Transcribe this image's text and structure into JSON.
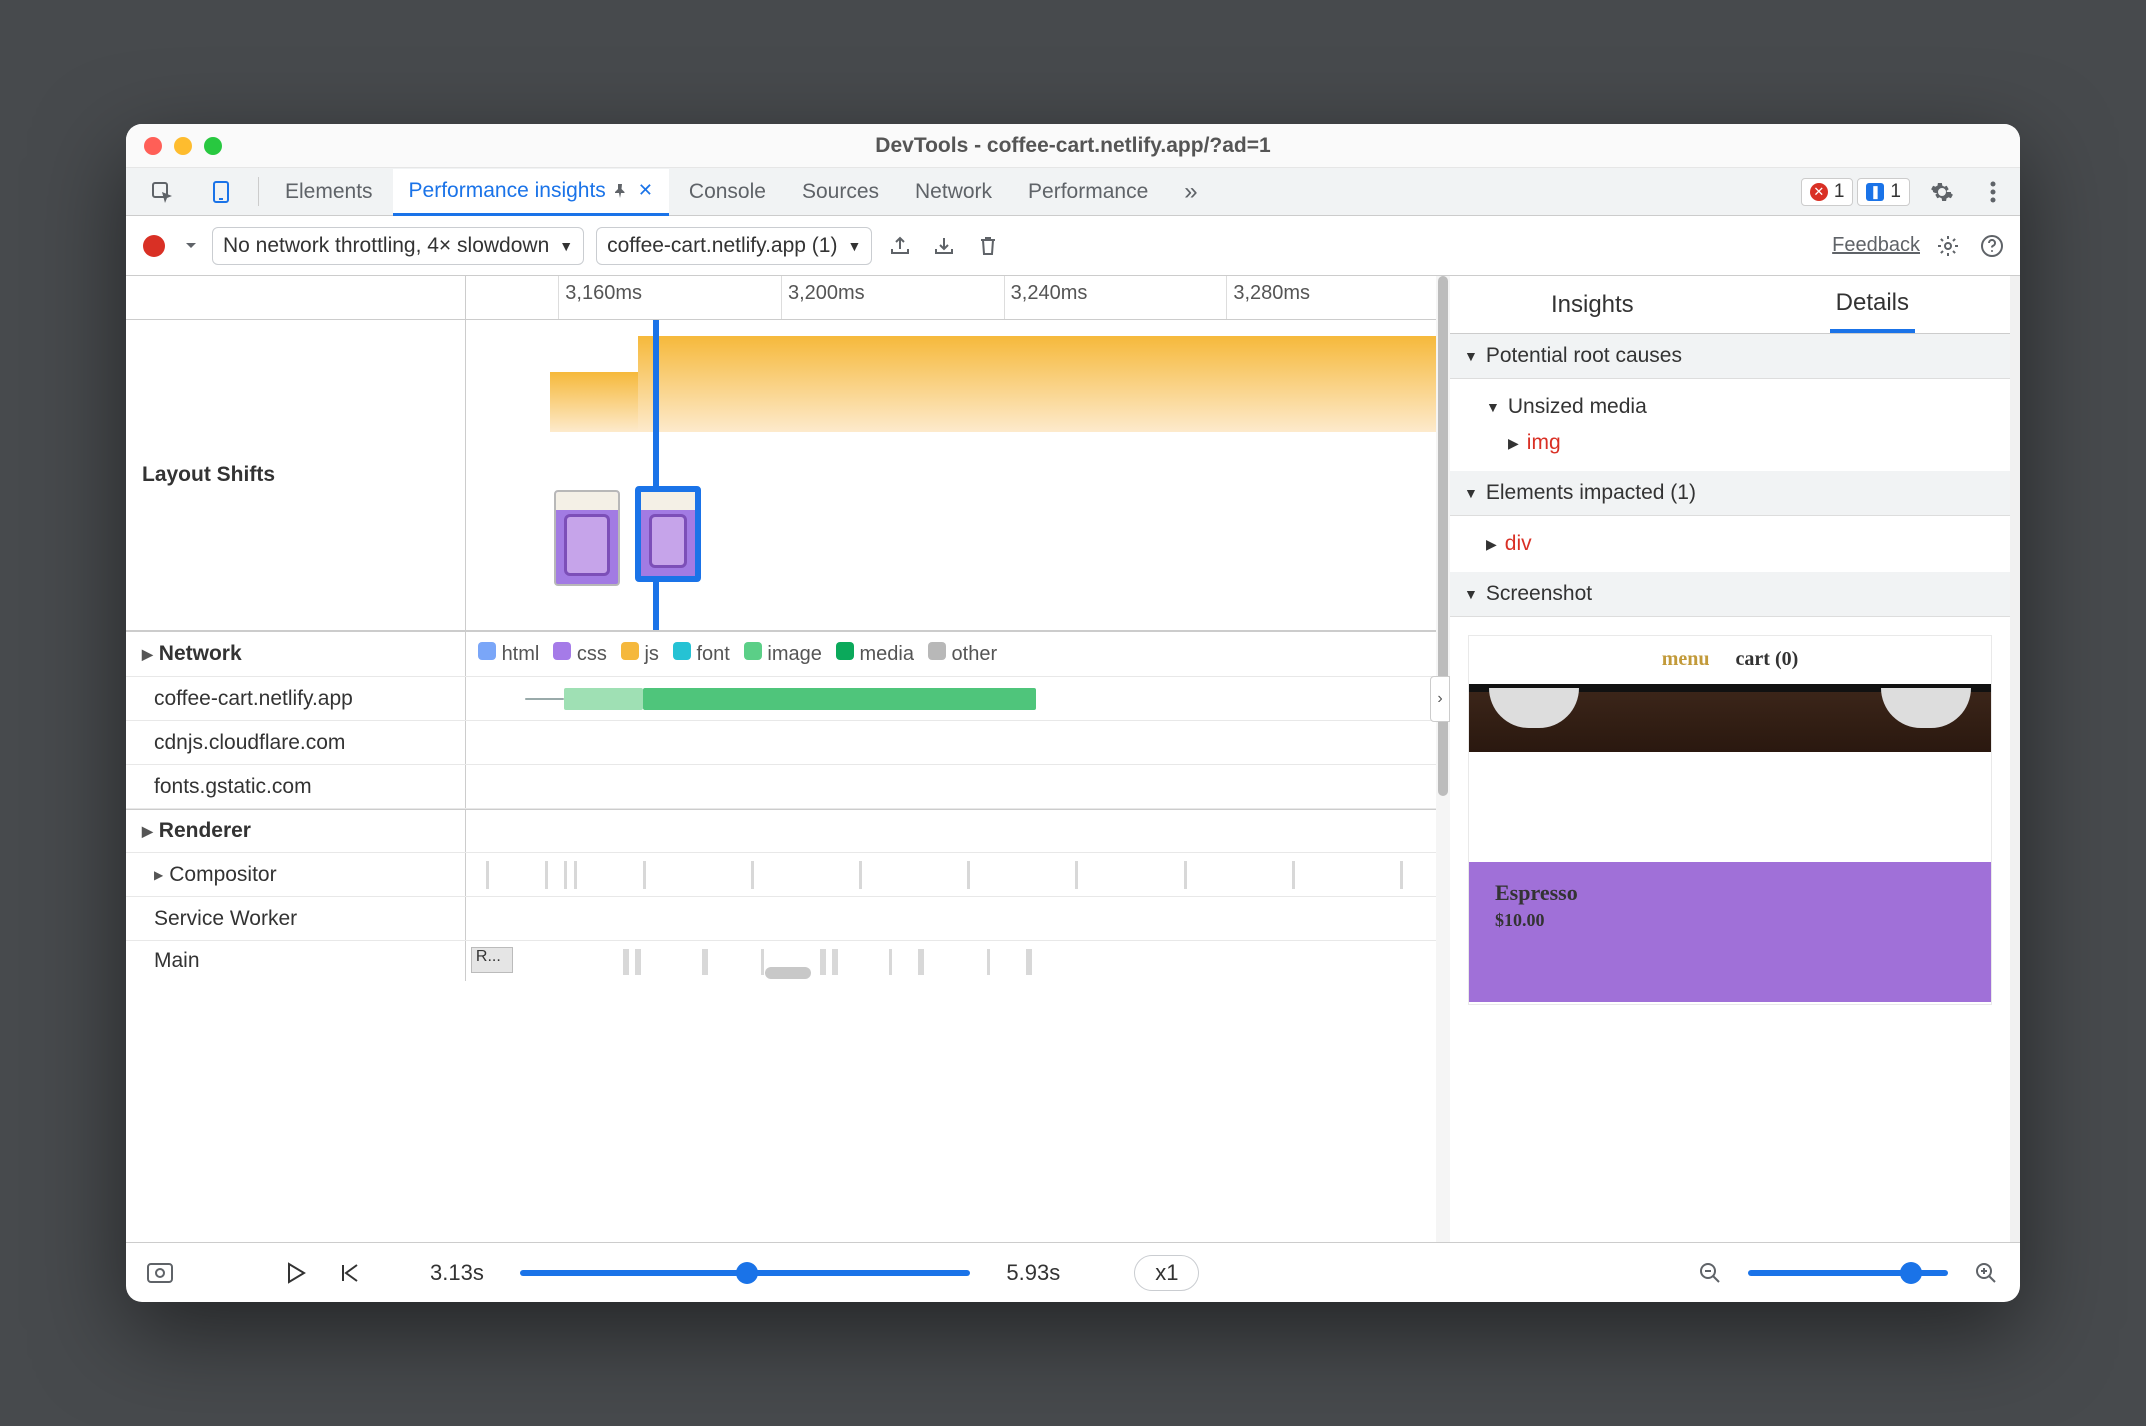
{
  "window": {
    "title": "DevTools - coffee-cart.netlify.app/?ad=1"
  },
  "tabs": {
    "items": [
      "Elements",
      "Performance insights",
      "Console",
      "Sources",
      "Network",
      "Performance"
    ],
    "active_index": 1,
    "more_glyph": "»",
    "errors_count": "1",
    "issues_count": "1"
  },
  "toolbar": {
    "throttle": "No network throttling, 4× slowdown",
    "recording": "coffee-cart.netlify.app (1)",
    "feedback": "Feedback"
  },
  "timeline": {
    "ticks": [
      "3,160ms",
      "3,200ms",
      "3,240ms",
      "3,280ms"
    ],
    "layout_shifts_label": "Layout Shifts",
    "network_label": "Network",
    "renderer_label": "Renderer",
    "network_hosts": [
      "coffee-cart.netlify.app",
      "cdnjs.cloudflare.com",
      "fonts.gstatic.com"
    ],
    "renderer_threads": [
      "Compositor",
      "Service Worker",
      "Main"
    ],
    "legend": [
      {
        "label": "html",
        "color": "#7aa6f8"
      },
      {
        "label": "css",
        "color": "#a57be8"
      },
      {
        "label": "js",
        "color": "#f5b83d"
      },
      {
        "label": "font",
        "color": "#25c2d4"
      },
      {
        "label": "image",
        "color": "#5bcf87"
      },
      {
        "label": "media",
        "color": "#0ba95b"
      },
      {
        "label": "other",
        "color": "#b8b8b8"
      }
    ],
    "main_block_label": "R..."
  },
  "right": {
    "tabs": [
      "Insights",
      "Details"
    ],
    "active_index": 1,
    "root_causes_hdr": "Potential root causes",
    "unsized_media": "Unsized media",
    "unsized_child": "img",
    "impacted_hdr": "Elements impacted (1)",
    "impacted_child": "div",
    "screenshot_hdr": "Screenshot",
    "preview": {
      "menu": "menu",
      "cart": "cart (0)",
      "product": "Espresso",
      "price": "$10.00"
    }
  },
  "footer": {
    "start": "3.13s",
    "end": "5.93s",
    "speed": "x1"
  }
}
